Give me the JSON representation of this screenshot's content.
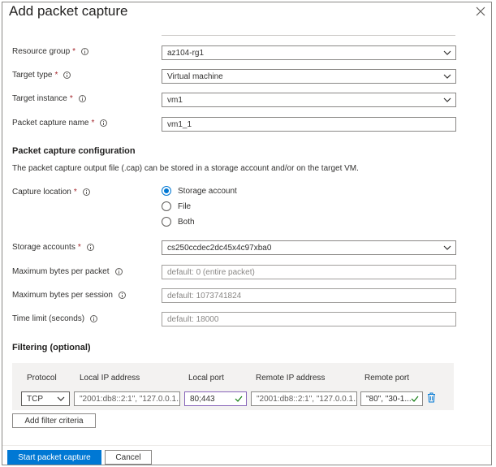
{
  "panel": {
    "title": "Add packet capture"
  },
  "form": {
    "resource_group": {
      "label": "Resource group",
      "value": "az104-rg1"
    },
    "target_type": {
      "label": "Target type",
      "value": "Virtual machine"
    },
    "target_instance": {
      "label": "Target instance",
      "value": "vm1"
    },
    "packet_capture_name": {
      "label": "Packet capture name",
      "value": "vm1_1"
    }
  },
  "config": {
    "heading": "Packet capture configuration",
    "description": "The packet capture output file (.cap) can be stored in a storage account and/or on the target VM.",
    "capture_location": {
      "label": "Capture location",
      "options": [
        "Storage account",
        "File",
        "Both"
      ],
      "selected": "Storage account"
    },
    "storage_accounts": {
      "label": "Storage accounts",
      "value": "cs250ccdec2dc45x4c97xba0"
    },
    "max_bytes_packet": {
      "label": "Maximum bytes per packet",
      "placeholder": "default: 0 (entire packet)"
    },
    "max_bytes_session": {
      "label": "Maximum bytes per session",
      "placeholder": "default: 1073741824"
    },
    "time_limit": {
      "label": "Time limit (seconds)",
      "placeholder": "default: 18000"
    }
  },
  "filtering": {
    "heading": "Filtering (optional)",
    "columns": [
      "Protocol",
      "Local IP address",
      "Local port",
      "Remote IP address",
      "Remote port"
    ],
    "row": {
      "protocol": "TCP",
      "local_ip": "\"2001:db8::2:1\", \"127.0.0.1...",
      "local_port": "80;443",
      "remote_ip": "\"2001:db8::2:1\", \"127.0.0.1...",
      "remote_port": "\"80\", \"30-1..."
    },
    "add_button": "Add filter criteria"
  },
  "footer": {
    "start_button": "Start packet capture",
    "cancel_button": "Cancel"
  },
  "colors": {
    "accent": "#0078d4",
    "required": "#a4262c",
    "valid": "#107c10"
  }
}
